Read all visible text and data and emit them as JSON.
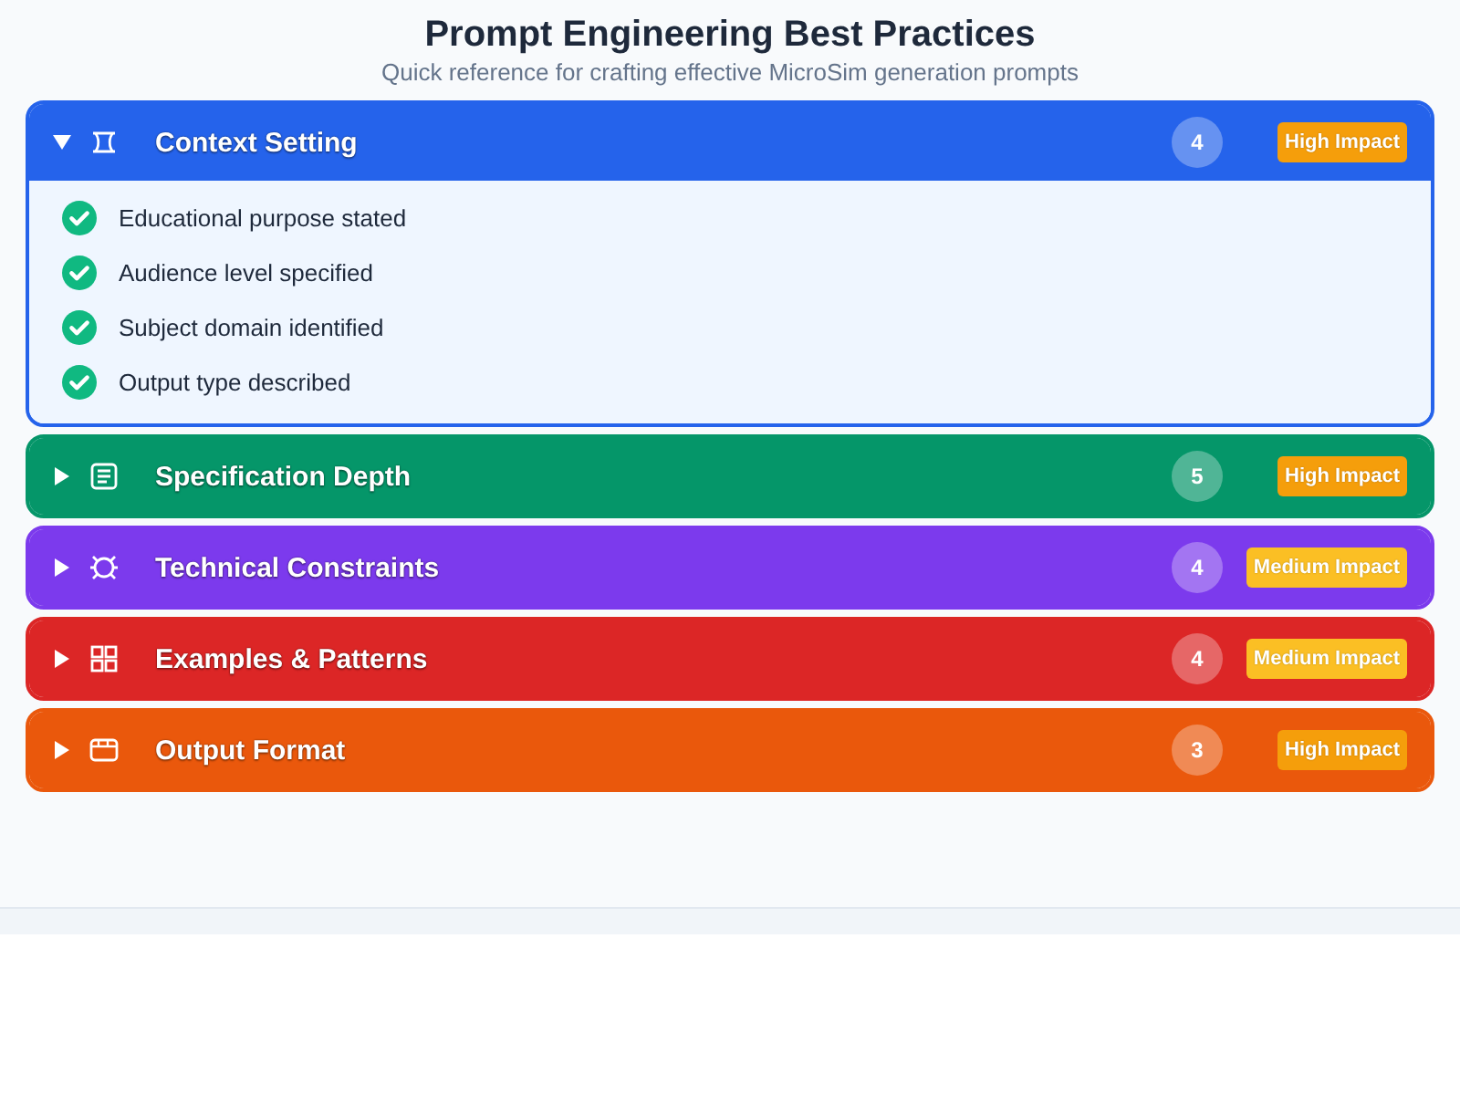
{
  "header": {
    "title": "Prompt Engineering Best Practices",
    "subtitle": "Quick reference for crafting effective MicroSim generation prompts"
  },
  "sections": [
    {
      "title": "Context Setting",
      "color": "#2563eb",
      "expanded": true,
      "count": "4",
      "badge": {
        "label": "High Impact",
        "color": "#f59e0b"
      },
      "items": [
        {
          "text": "Educational purpose stated",
          "checked": true
        },
        {
          "text": "Audience level specified",
          "checked": true
        },
        {
          "text": "Subject domain identified",
          "checked": true
        },
        {
          "text": "Output type described",
          "checked": true
        }
      ]
    },
    {
      "title": "Specification Depth",
      "color": "#059669",
      "expanded": false,
      "count": "5",
      "badge": {
        "label": "High Impact",
        "color": "#f59e0b"
      }
    },
    {
      "title": "Technical Constraints",
      "color": "#7c3aed",
      "expanded": false,
      "count": "4",
      "badge": {
        "label": "Medium Impact",
        "color": "#fbbf24"
      }
    },
    {
      "title": "Examples & Patterns",
      "color": "#dc2626",
      "expanded": false,
      "count": "4",
      "badge": {
        "label": "Medium Impact",
        "color": "#fbbf24"
      }
    },
    {
      "title": "Output Format",
      "color": "#ea580c",
      "expanded": false,
      "count": "3",
      "badge": {
        "label": "High Impact",
        "color": "#f59e0b"
      }
    }
  ]
}
